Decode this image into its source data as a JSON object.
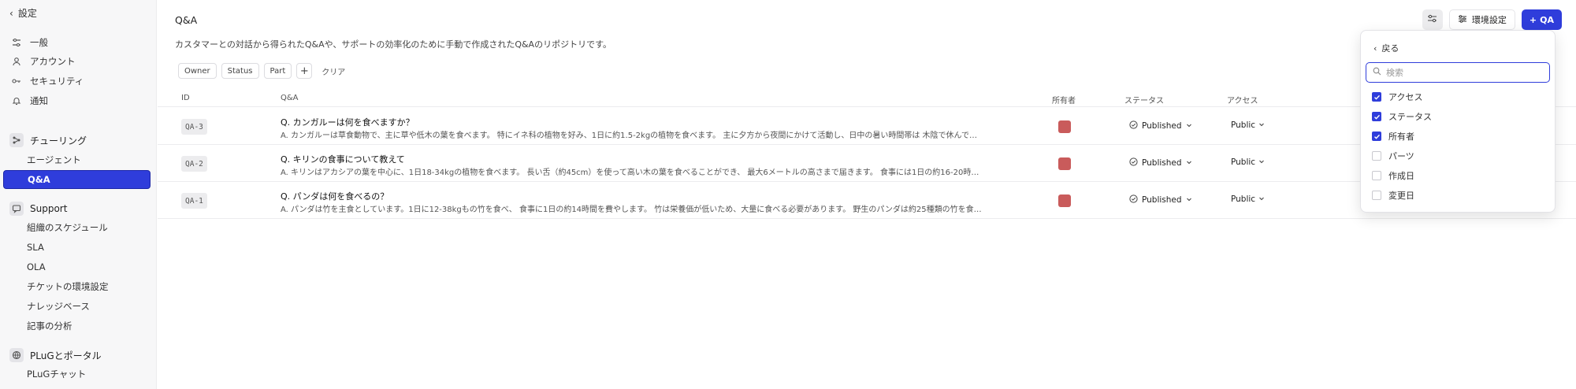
{
  "sidebar": {
    "back_label": "設定",
    "general": [
      {
        "label": "一般",
        "icon": "sliders-icon"
      },
      {
        "label": "アカウント",
        "icon": "user-icon"
      },
      {
        "label": "セキュリティ",
        "icon": "key-icon"
      },
      {
        "label": "通知",
        "icon": "bell-icon"
      }
    ],
    "tuning": {
      "title": "チューリング",
      "items": [
        {
          "label": "エージェント"
        },
        {
          "label": "Q&A",
          "active": true
        }
      ]
    },
    "support": {
      "title": "Support",
      "items": [
        {
          "label": "組織のスケジュール"
        },
        {
          "label": "SLA"
        },
        {
          "label": "OLA"
        },
        {
          "label": "チケットの環境設定"
        },
        {
          "label": "ナレッジベース"
        },
        {
          "label": "記事の分析"
        }
      ]
    },
    "plug": {
      "title": "PLuGとポータル",
      "items": [
        {
          "label": "PLuGチャット"
        }
      ]
    }
  },
  "header": {
    "title": "Q&A",
    "description": "カスタマーとの対話から得られたQ&Aや、サポートの効率化のために手動で作成されたQ&Aのリポジトリです。",
    "settings_label": "環境設定",
    "add_label": "QA"
  },
  "filters": {
    "chips": [
      "Owner",
      "Status",
      "Part"
    ],
    "plus": "+",
    "clear": "クリア"
  },
  "table": {
    "columns": {
      "id": "ID",
      "qa": "Q&A",
      "owner": "所有者",
      "status": "ステータス",
      "access": "アクセス"
    },
    "rows": [
      {
        "id": "QA-3",
        "question": "Q. カンガルーは何を食べますか？",
        "answer": "A. カンガルーは草食動物で、主に草や低木の葉を食べます。 特にイネ科の植物を好み、1日に約1.5-2kgの植物を食べます。 主に夕方から夜間にかけて活動し、日中の暑い時間帯は 木陰で休んで…",
        "status": "Published",
        "access": "Public"
      },
      {
        "id": "QA-2",
        "question": "Q. キリンの食事について教えて",
        "answer": "A. キリンはアカシアの葉を中心に、1日18-34kgの植物を食べます。 長い舌（約45cm）を使って高い木の葉を食べることができ、 最大6メートルの高さまで届きます。 食事には1日の約16-20時…",
        "status": "Published",
        "access": "Public"
      },
      {
        "id": "QA-1",
        "question": "Q. パンダは何を食べるの？",
        "answer": "A. パンダは竹を主食としています。1日に12-38kgもの竹を食べ、 食事に1日の約14時間を費やします。 竹は栄養価が低いため、大量に食べる必要があります。 野生のパンダは約25種類の竹を食…",
        "status": "Published",
        "access": "Public"
      }
    ]
  },
  "dropdown": {
    "back_label": "戻る",
    "search_placeholder": "検索",
    "options": [
      {
        "label": "アクセス",
        "checked": true
      },
      {
        "label": "ステータス",
        "checked": true
      },
      {
        "label": "所有者",
        "checked": true
      },
      {
        "label": "パーツ",
        "checked": false
      },
      {
        "label": "作成日",
        "checked": false
      },
      {
        "label": "変更日",
        "checked": false
      }
    ]
  },
  "colors": {
    "accent": "#2f3ddb",
    "owner_avatar": "#c95b5b"
  }
}
